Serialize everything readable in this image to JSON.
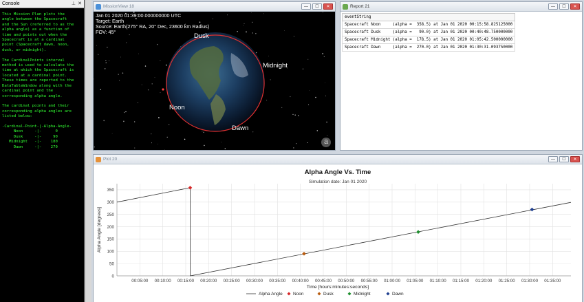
{
  "console": {
    "title": "Console",
    "lines": [
      "This Mission Plan plots the",
      "angle between the Spacecraft",
      "and the Sun (referred to as the",
      "alpha angle) as a function of",
      "time and points out when the",
      "Spacecraft is at a cardinal",
      "point (Spacecraft dawn, noon,",
      "dusk, or midnight).",
      "",
      "The CardinalPoints interval",
      "method is used to calculate the",
      "time at which the Spacecraft is",
      "located at a cardinal point.",
      "These times are reported to the",
      "DataTableWindow along with the",
      "cardinal point and the",
      "corresponding alpha angle.",
      "",
      "The cardinal points and their",
      "corresponding alpha angles are",
      "listed below:",
      "",
      "-Cardinal-Point-|-Alpha-Angle-",
      "     Noon     -|-      0",
      "     Dusk     -|-     90",
      "   Midnight   -|-    180",
      "     Dawn     -|-    270"
    ]
  },
  "mission": {
    "title": "MissionView 18",
    "hud": [
      "Jan 01 2020 01:39:00.000000000 UTC",
      "Target: Earth",
      "Source: Earth(275° RA, 20° Dec, 23600 km Radius)",
      "FOV: 45°"
    ],
    "labels": {
      "dusk": "Dusk",
      "midnight": "Midnight",
      "noon": "Noon",
      "dawn": "Dawn"
    },
    "logo": "a"
  },
  "report": {
    "title": "Report 21",
    "header": "eventString",
    "rows": [
      "Spacecraft Noon     (alpha =  358.5) at Jan 01 2020 00:15:58.825125000",
      "Spacecraft Dusk     (alpha =   90.0) at Jan 01 2020 00:40:48.750000000",
      "Spacecraft Midnight (alpha =  178.5) at Jan 01 2020 01:05:42.500000000",
      "Spacecraft Dawn     (alpha =  270.0) at Jan 01 2020 01:30:31.093750000"
    ]
  },
  "plot": {
    "title": "Plot 20"
  },
  "chart_data": {
    "type": "line",
    "title": "Alpha Angle Vs. Time",
    "subtitle": "Simulation date: Jan 01 2020",
    "xlabel": "Time [hours:minutes:seconds]",
    "ylabel": "Alpha Angle [degrees]",
    "xlim": [
      "00:00:00",
      "01:39:00"
    ],
    "ylim": [
      0,
      375
    ],
    "yticks": [
      0,
      50,
      100,
      150,
      200,
      250,
      300,
      350
    ],
    "xticks": [
      "00:05:00",
      "00:10:00",
      "00:15:00",
      "00:20:00",
      "00:25:00",
      "00:30:00",
      "00:35:00",
      "00:40:00",
      "00:45:00",
      "00:50:00",
      "00:55:00",
      "01:00:00",
      "01:05:00",
      "01:10:00",
      "01:15:00",
      "01:20:00",
      "01:25:00",
      "01:30:00",
      "01:35:00"
    ],
    "grid": true,
    "legend_position": "bottom",
    "series": [
      {
        "name": "Alpha Angle",
        "color": "#333333",
        "x": [
          "00:00:00",
          "00:15:58",
          "00:15:59",
          "01:39:00"
        ],
        "y": [
          300,
          358.5,
          0,
          299
        ]
      }
    ],
    "markers": [
      {
        "name": "Noon",
        "color": "#d62728",
        "x": "00:15:58",
        "y": 358.5
      },
      {
        "name": "Dusk",
        "color": "#b85c10",
        "x": "00:40:48",
        "y": 90
      },
      {
        "name": "Midnight",
        "color": "#1f8f2f",
        "x": "01:05:42",
        "y": 178.5
      },
      {
        "name": "Dawn",
        "color": "#1f3f8f",
        "x": "01:30:31",
        "y": 270
      }
    ]
  }
}
